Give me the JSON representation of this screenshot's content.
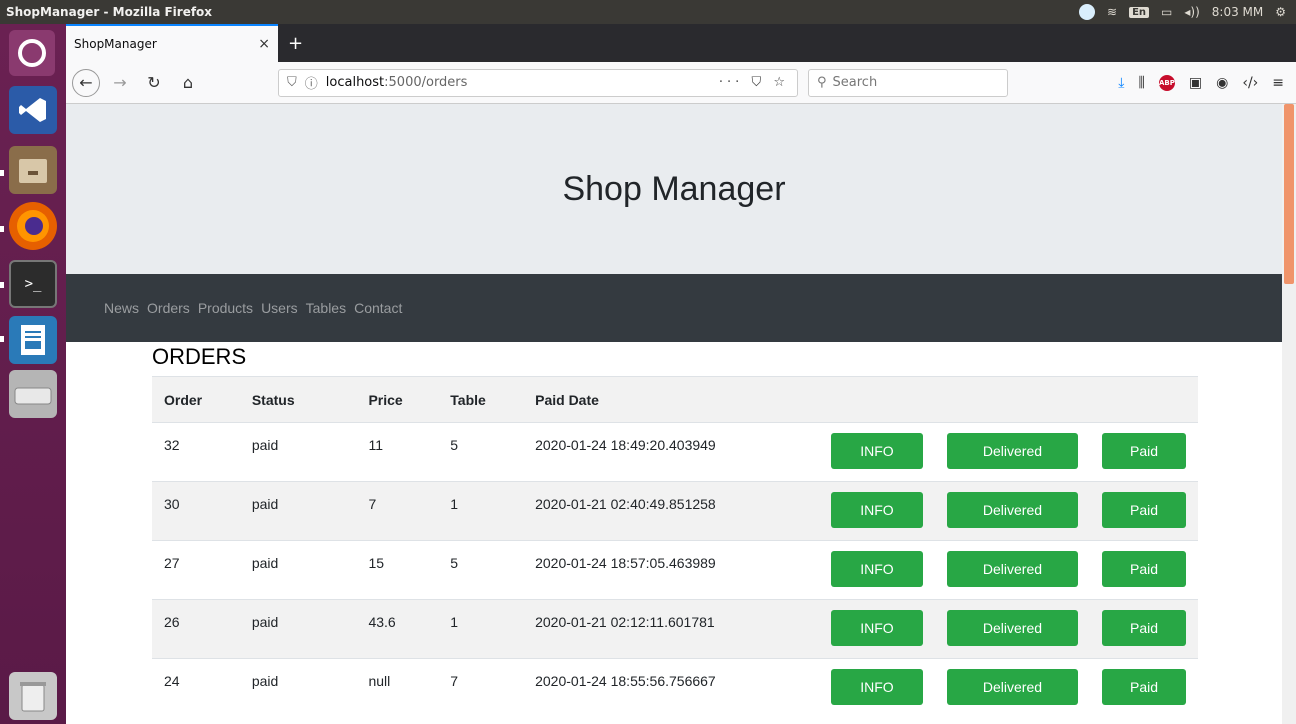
{
  "os": {
    "window_title": "ShopManager - Mozilla Firefox",
    "clock": "8:03 MM",
    "keyboard": "En",
    "volume": "◂))"
  },
  "browser": {
    "tab_title": "ShopManager",
    "url_host": "localhost",
    "url_path": ":5000/orders",
    "search_placeholder": "Search"
  },
  "page": {
    "title": "Shop Manager",
    "nav": [
      "News",
      "Orders",
      "Products",
      "Users",
      "Tables",
      "Contact"
    ],
    "heading": "ORDERS",
    "columns": [
      "Order",
      "Status",
      "Price",
      "Table",
      "Paid Date"
    ],
    "buttons": {
      "info": "INFO",
      "delivered": "Delivered",
      "paid": "Paid"
    },
    "orders": [
      {
        "order": "32",
        "status": "paid",
        "price": "11",
        "table": "5",
        "paid_date": "2020-01-24 18:49:20.403949"
      },
      {
        "order": "30",
        "status": "paid",
        "price": "7",
        "table": "1",
        "paid_date": "2020-01-21 02:40:49.851258"
      },
      {
        "order": "27",
        "status": "paid",
        "price": "15",
        "table": "5",
        "paid_date": "2020-01-24 18:57:05.463989"
      },
      {
        "order": "26",
        "status": "paid",
        "price": "43.6",
        "table": "1",
        "paid_date": "2020-01-21 02:12:11.601781"
      },
      {
        "order": "24",
        "status": "paid",
        "price": "null",
        "table": "7",
        "paid_date": "2020-01-24 18:55:56.756667"
      }
    ]
  },
  "colors": {
    "accent": "#28a745",
    "navbar": "#343a40",
    "jumbotron": "#e9ecef"
  }
}
